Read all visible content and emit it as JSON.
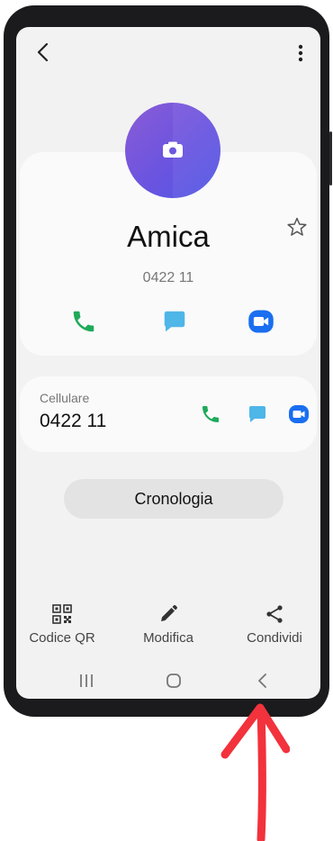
{
  "contact": {
    "name": "Amica",
    "number": "0422 11",
    "phone_label": "Cellulare",
    "phone_number": "0422 11"
  },
  "buttons": {
    "history": "Cronologia"
  },
  "bottom_bar": {
    "qr_label": "Codice QR",
    "edit_label": "Modifica",
    "share_label": "Condividi"
  },
  "colors": {
    "call": "#1faa59",
    "message": "#4fb6e8",
    "video": "#1a6ef0",
    "annotation_arrow": "#f2323c"
  },
  "icons": [
    "back-icon",
    "more-icon",
    "camera-icon",
    "star-icon",
    "call-icon",
    "message-icon",
    "video-icon",
    "qr-icon",
    "edit-icon",
    "share-icon",
    "recents-icon",
    "home-icon",
    "nav-back-icon"
  ]
}
